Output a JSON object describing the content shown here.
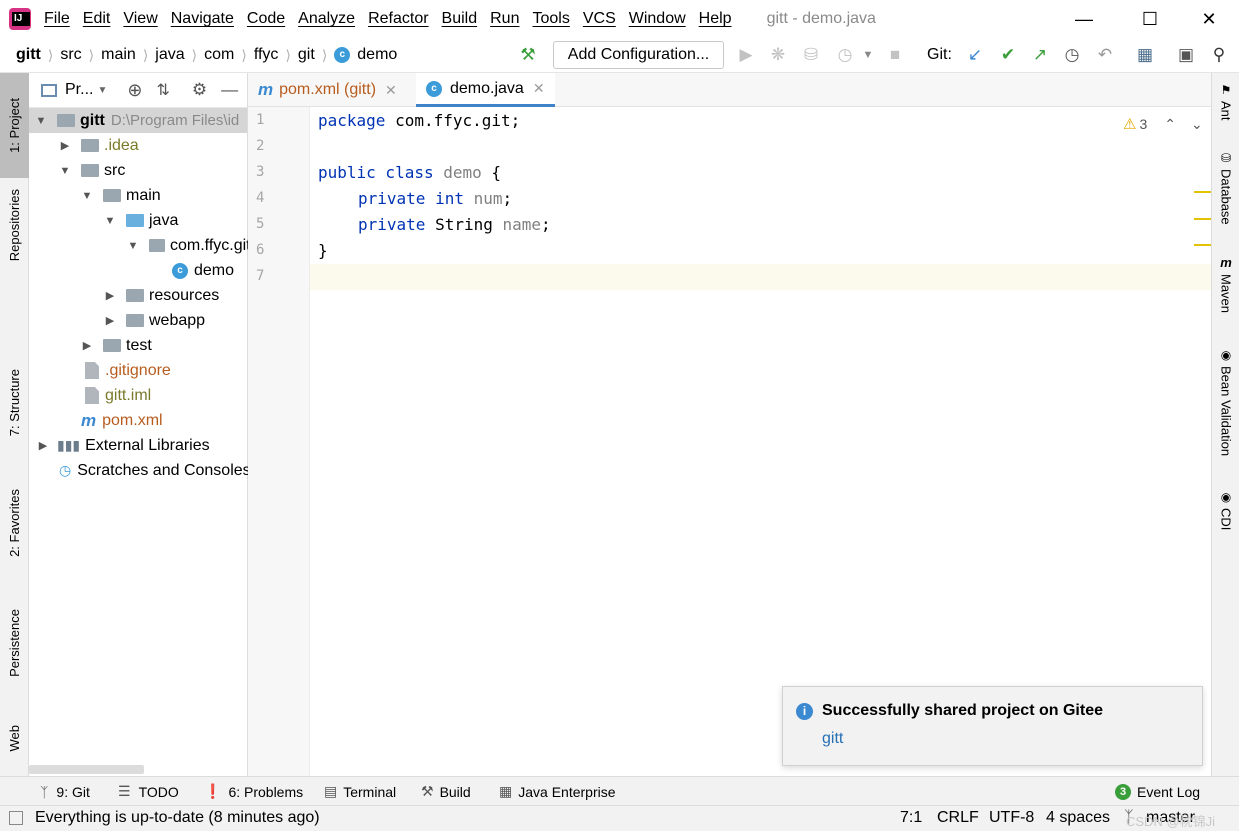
{
  "menu": [
    "File",
    "Edit",
    "View",
    "Navigate",
    "Code",
    "Analyze",
    "Refactor",
    "Build",
    "Run",
    "Tools",
    "VCS",
    "Window",
    "Help"
  ],
  "window_title": "gitt - demo.java",
  "breadcrumbs": [
    "gitt",
    "src",
    "main",
    "java",
    "com",
    "ffyc",
    "git",
    "demo"
  ],
  "toolbar": {
    "add_configuration": "Add Configuration...",
    "git_label": "Git:"
  },
  "left_tabs": {
    "project": "1: Project",
    "repositories": "Repositories",
    "structure": "7: Structure",
    "favorites": "2: Favorites",
    "persistence": "Persistence",
    "web": "Web"
  },
  "right_tabs": {
    "ant": "Ant",
    "database": "Database",
    "maven": "Maven",
    "bean": "Bean Validation",
    "cdi": "CDI"
  },
  "project_panel": {
    "title": "Pr...",
    "root_name": "gitt",
    "root_path": "D:\\Program Files\\id",
    "items": [
      ".idea",
      "src",
      "main",
      "java",
      "com.ffyc.git",
      "demo",
      "resources",
      "webapp",
      "test",
      ".gitignore",
      "gitt.iml",
      "pom.xml",
      "External Libraries",
      "Scratches and Consoles"
    ]
  },
  "editor_tabs": [
    {
      "label": "pom.xml (gitt)",
      "icon": "m"
    },
    {
      "label": "demo.java",
      "icon": "c"
    }
  ],
  "code": {
    "line_numbers": [
      "1",
      "2",
      "3",
      "4",
      "5",
      "6",
      "7"
    ],
    "l1_kw": "package",
    "l1_rest": " com.ffyc.git;",
    "l3_kw": "public class",
    "l3_name": " demo",
    "l3_rest": " {",
    "l4_kw": "private int",
    "l4_name": " num",
    "l4_rest": ";",
    "l5_kw": "private",
    "l5_type": " String",
    "l5_name": " name",
    "l5_rest": ";",
    "l6": "}"
  },
  "warnings": {
    "count": "3"
  },
  "bottom_tabs": {
    "git": "9: Git",
    "todo": "TODO",
    "problems": "6: Problems",
    "terminal": "Terminal",
    "build": "Build",
    "java_enterprise": "Java Enterprise",
    "event_log": "Event Log",
    "event_count": "3"
  },
  "status": {
    "message": "Everything is up-to-date (8 minutes ago)",
    "position": "7:1",
    "line_sep": "CRLF",
    "encoding": "UTF-8",
    "indent": "4 spaces",
    "branch": "master",
    "watermark": "CSDN @帎锦Ji"
  },
  "notification": {
    "title": "Successfully shared project on Gitee",
    "link": "gitt"
  },
  "colors": {
    "accent": "#4083c9",
    "keyword": "#0033b3",
    "green": "#3a9e3a",
    "warning": "#e3a600"
  }
}
